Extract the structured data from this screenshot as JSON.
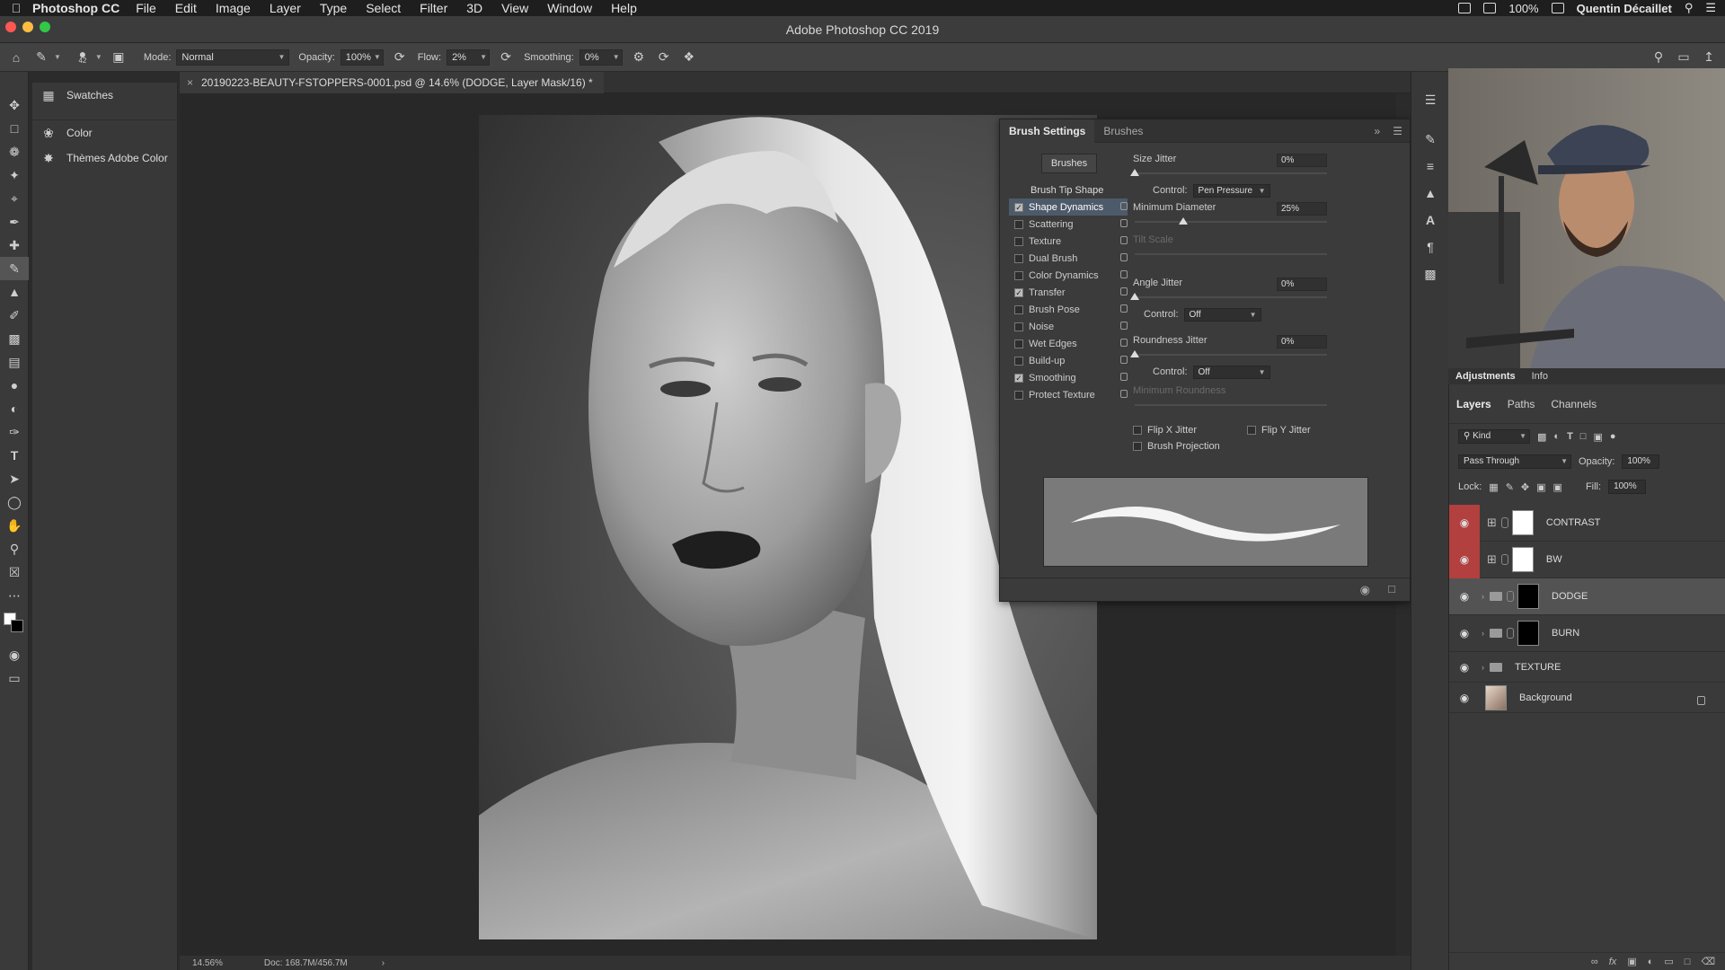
{
  "menubar": {
    "app_name": "Photoshop CC",
    "items": [
      "File",
      "Edit",
      "Image",
      "Layer",
      "Type",
      "Select",
      "Filter",
      "3D",
      "View",
      "Window",
      "Help"
    ],
    "battery": "100%",
    "user": "Quentin Décaillet"
  },
  "window": {
    "title": "Adobe Photoshop CC 2019"
  },
  "options_bar": {
    "brush_size": "42",
    "mode_label": "Mode:",
    "mode_value": "Normal",
    "opacity_label": "Opacity:",
    "opacity_value": "100%",
    "flow_label": "Flow:",
    "flow_value": "2%",
    "smoothing_label": "Smoothing:",
    "smoothing_value": "0%"
  },
  "side_panel": {
    "items": [
      {
        "label": "Swatches",
        "icon": "grid-icon"
      },
      {
        "label": "Color",
        "icon": "color-wheel-icon"
      },
      {
        "label": "Thèmes Adobe Color",
        "icon": "adobe-color-icon"
      }
    ]
  },
  "document": {
    "tab_title": "20190223-BEAUTY-FSTOPPERS-0001.psd @ 14.6% (DODGE, Layer Mask/16) *",
    "close_glyph": "×"
  },
  "brush_settings": {
    "tabs": [
      "Brush Settings",
      "Brushes"
    ],
    "brushes_button": "Brushes",
    "tip_shape": "Brush Tip Shape",
    "options": [
      {
        "label": "Shape Dynamics",
        "checked": true,
        "active": true
      },
      {
        "label": "Scattering",
        "checked": false
      },
      {
        "label": "Texture",
        "checked": false
      },
      {
        "label": "Dual Brush",
        "checked": false
      },
      {
        "label": "Color Dynamics",
        "checked": false
      },
      {
        "label": "Transfer",
        "checked": true
      },
      {
        "label": "Brush Pose",
        "checked": false
      },
      {
        "label": "Noise",
        "checked": false
      },
      {
        "label": "Wet Edges",
        "checked": false
      },
      {
        "label": "Build-up",
        "checked": false
      },
      {
        "label": "Smoothing",
        "checked": true
      },
      {
        "label": "Protect Texture",
        "checked": false
      }
    ],
    "size_jitter_label": "Size Jitter",
    "size_jitter_value": "0%",
    "control_label": "Control:",
    "size_control_value": "Pen Pressure",
    "min_diameter_label": "Minimum Diameter",
    "min_diameter_value": "25%",
    "tilt_scale_label": "Tilt Scale",
    "angle_jitter_label": "Angle Jitter",
    "angle_jitter_value": "0%",
    "angle_control_value": "Off",
    "roundness_jitter_label": "Roundness Jitter",
    "roundness_jitter_value": "0%",
    "roundness_control_value": "Off",
    "min_roundness_label": "Minimum Roundness",
    "flip_x_label": "Flip X Jitter",
    "flip_y_label": "Flip Y Jitter",
    "brush_projection_label": "Brush Projection",
    "levels": {
      "size_jitter": 0,
      "min_diameter": 0.25,
      "angle_jitter": 0,
      "roundness_jitter": 0
    }
  },
  "adjustments_bar": {
    "tabs": [
      "Adjustments",
      "Info"
    ]
  },
  "layers_panel": {
    "tabs": [
      "Layers",
      "Paths",
      "Channels"
    ],
    "filter_label": "Kind",
    "blend_mode": "Pass Through",
    "opacity_label": "Opacity:",
    "opacity_value": "100%",
    "lock_label": "Lock:",
    "fill_label": "Fill:",
    "fill_value": "100%",
    "layers": [
      {
        "name": "CONTRAST",
        "type": "adjustment",
        "eye_red": true
      },
      {
        "name": "BW",
        "type": "adjustment",
        "eye_red": true
      },
      {
        "name": "DODGE",
        "type": "group-mask-black",
        "selected": true
      },
      {
        "name": "BURN",
        "type": "group-mask-black"
      },
      {
        "name": "TEXTURE",
        "type": "group"
      },
      {
        "name": "Background",
        "type": "image",
        "locked": true
      }
    ]
  },
  "status_bar": {
    "zoom": "14.56%",
    "doc_info": "Doc: 168.7M/456.7M"
  },
  "colors": {
    "eye_highlight": "#b2403e",
    "active_option": "#4d5a6a"
  }
}
